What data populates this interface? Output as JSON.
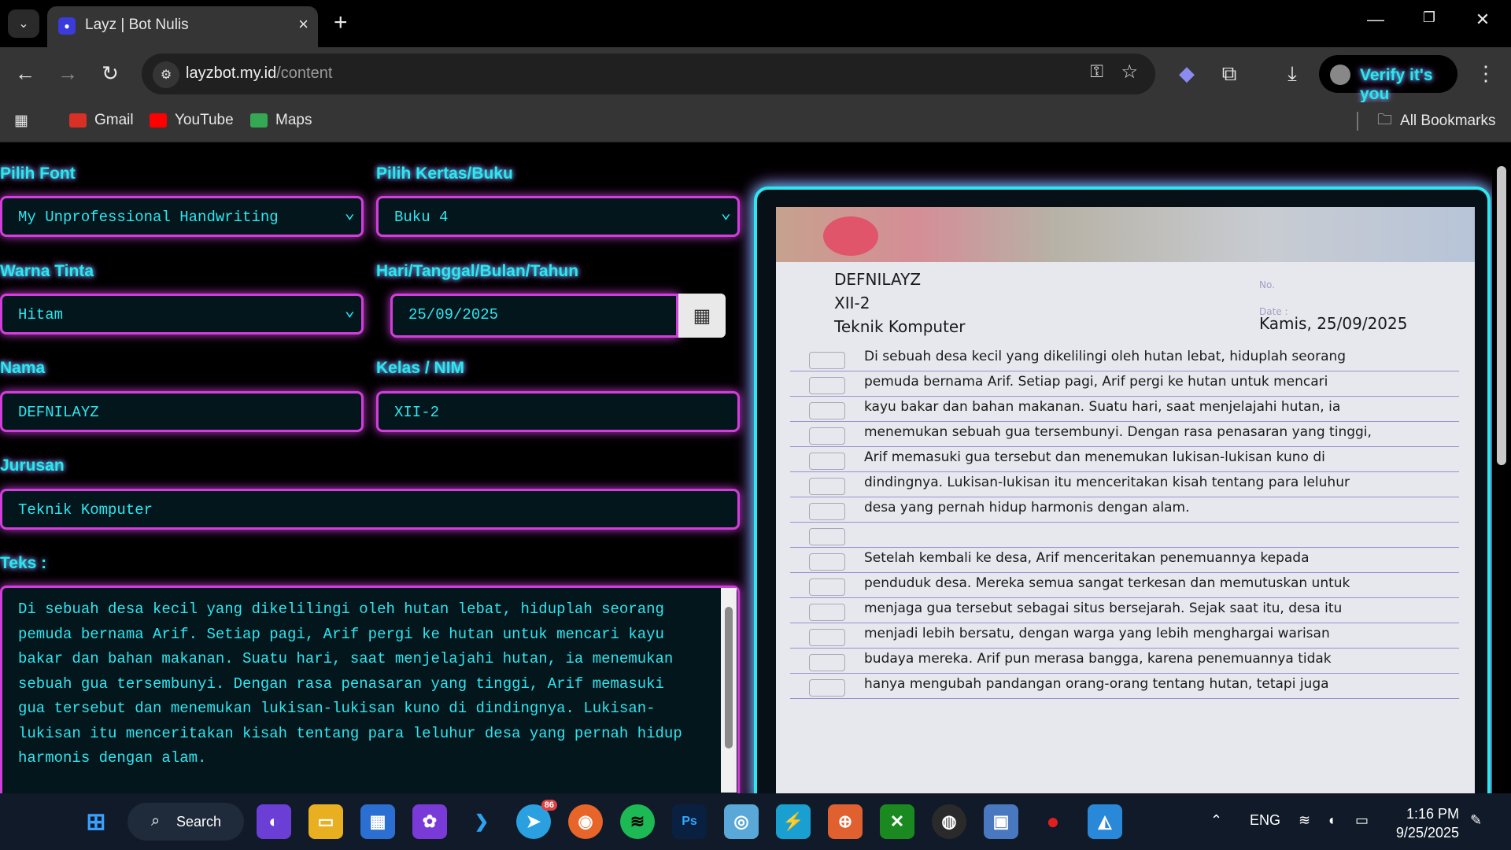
{
  "browser": {
    "tab_title": "Layz | Bot Nulis",
    "url_domain": "layzbot.my.id",
    "url_path": "/content",
    "verify_label": "Verify it's you"
  },
  "bookmarks": {
    "items": [
      {
        "label": "Gmail",
        "color": "#d93025"
      },
      {
        "label": "YouTube",
        "color": "#ff0000"
      },
      {
        "label": "Maps",
        "color": "#34a853"
      }
    ],
    "all_label": "All Bookmarks"
  },
  "form": {
    "font_label": "Pilih Font",
    "font_value": "My Unprofessional Handwriting",
    "paper_label": "Pilih Kertas/Buku",
    "paper_value": "Buku 4",
    "ink_label": "Warna Tinta",
    "ink_value": "Hitam",
    "date_label": "Hari/Tanggal/Bulan/Tahun",
    "date_value": "25/09/2025",
    "name_label": "Nama",
    "name_value": "DEFNILAYZ",
    "class_label": "Kelas / NIM",
    "class_value": "XII-2",
    "major_label": "Jurusan",
    "major_value": "Teknik Komputer",
    "text_label": "Teks :",
    "text_value": "Di sebuah desa kecil yang dikelilingi oleh hutan lebat, hiduplah seorang pemuda bernama Arif. Setiap pagi, Arif pergi ke hutan untuk mencari kayu bakar dan bahan makanan. Suatu hari, saat menjelajahi hutan, ia menemukan sebuah gua tersembunyi. Dengan rasa penasaran yang tinggi, Arif memasuki gua tersebut dan menemukan lukisan-lukisan kuno di dindingnya. Lukisan-lukisan itu menceritakan kisah tentang para leluhur desa yang pernah hidup harmonis dengan alam."
  },
  "preview": {
    "name": "DEFNILAYZ",
    "class": "XII-2",
    "major": "Teknik Komputer",
    "date": "Kamis, 25/09/2025",
    "no_label": "No.",
    "date_label": "Date :",
    "lines": [
      "Di sebuah desa kecil yang dikelilingi oleh hutan lebat, hiduplah seorang",
      "pemuda bernama Arif. Setiap pagi, Arif pergi ke hutan untuk mencari",
      "kayu bakar dan bahan makanan. Suatu hari, saat menjelajahi hutan, ia",
      "menemukan sebuah gua tersembunyi. Dengan rasa penasaran yang tinggi,",
      "Arif memasuki gua tersebut dan menemukan lukisan-lukisan kuno di",
      "dindingnya. Lukisan-lukisan itu menceritakan kisah tentang para leluhur",
      "desa yang pernah hidup harmonis dengan alam.",
      "",
      "Setelah kembali ke desa, Arif menceritakan penemuannya kepada",
      "penduduk desa. Mereka semua sangat terkesan dan memutuskan untuk",
      "menjaga gua tersebut sebagai situs bersejarah. Sejak saat itu, desa itu",
      "menjadi lebih bersatu, dengan warga yang lebih menghargai warisan",
      "budaya mereka. Arif pun merasa bangga, karena penemuannya tidak",
      "hanya mengubah pandangan orang-orang tentang hutan, tetapi juga"
    ]
  },
  "taskbar": {
    "search_label": "Search",
    "language": "ENG",
    "time": "1:16 PM",
    "date": "9/25/2025",
    "telegram_badge": "86"
  },
  "colors": {
    "neon_cyan": "#2ee6f0",
    "neon_magenta": "#d23edb"
  }
}
